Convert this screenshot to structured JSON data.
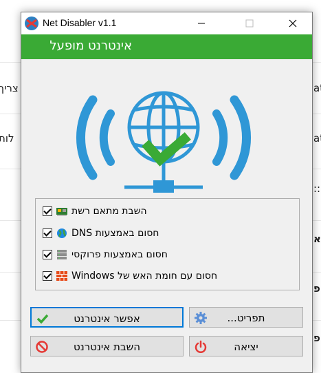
{
  "window": {
    "title": "Net Disabler v1.1",
    "status": "אינטרנט מופעל",
    "status_color": "#3aaa35",
    "accent": "#0078d7"
  },
  "options": [
    {
      "label": "השבת מתאם רשת",
      "checked": true,
      "icon": "network-adapter-icon"
    },
    {
      "label": "חסום באמצעות DNS",
      "checked": true,
      "icon": "globe-icon"
    },
    {
      "label": "חסום באמצעות פרוקסי",
      "checked": true,
      "icon": "server-icon"
    },
    {
      "label": "חסום עם חומת האש של Windows",
      "checked": true,
      "icon": "firewall-icon"
    }
  ],
  "buttons": {
    "allow": "אפשר אינטרנט",
    "menu": "תפריט...",
    "disable": "השבת אינטרנט",
    "exit": "יציאה"
  },
  "background": {
    "left_texts": [
      "צריך",
      "לות"
    ],
    "right_texts": [
      "ati",
      "ati",
      "::",
      "א",
      "פ",
      "פ"
    ]
  }
}
